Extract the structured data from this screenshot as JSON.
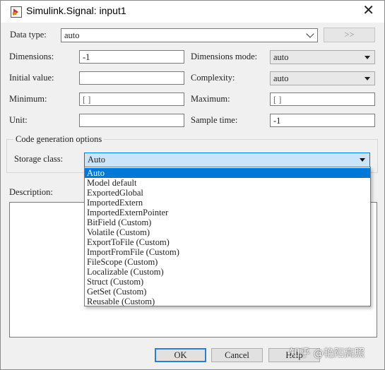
{
  "window": {
    "title": "Simulink.Signal: input1"
  },
  "data_type": {
    "label": "Data type:",
    "value": "auto",
    "more_button": ">>"
  },
  "dimensions": {
    "label": "Dimensions:",
    "value": "-1"
  },
  "dimensions_mode": {
    "label": "Dimensions mode:",
    "value": "auto"
  },
  "initial_value": {
    "label": "Initial value:",
    "value": ""
  },
  "complexity": {
    "label": "Complexity:",
    "value": "auto"
  },
  "minimum": {
    "label": "Minimum:",
    "value": "[ ]"
  },
  "maximum": {
    "label": "Maximum:",
    "value": "[ ]"
  },
  "unit": {
    "label": "Unit:",
    "value": ""
  },
  "sample_time": {
    "label": "Sample time:",
    "value": "-1"
  },
  "code_generation": {
    "title": "Code generation options",
    "storage_label": "Storage class:",
    "storage_value": "Auto",
    "options": [
      "Auto",
      "Model default",
      "ExportedGlobal",
      "ImportedExtern",
      "ImportedExternPointer",
      "BitField (Custom)",
      "Volatile (Custom)",
      "ExportToFile (Custom)",
      "ImportFromFile (Custom)",
      "FileScope (Custom)",
      "Localizable (Custom)",
      "Struct (Custom)",
      "GetSet (Custom)",
      "Reusable (Custom)"
    ],
    "selected_index": 0
  },
  "description": {
    "label": "Description:",
    "value": ""
  },
  "buttons": {
    "ok": "OK",
    "cancel": "Cancel",
    "help": "Help"
  },
  "watermark": "知乎 @艳阳高照"
}
